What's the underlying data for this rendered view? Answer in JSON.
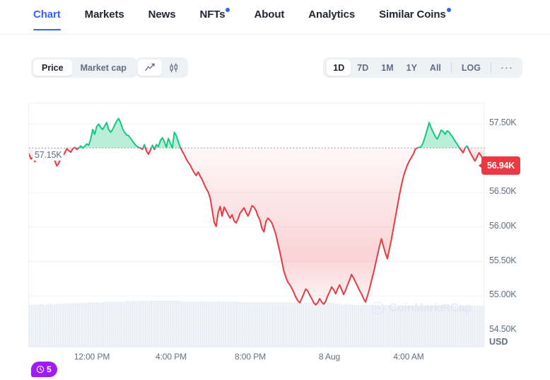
{
  "tabs": [
    {
      "label": "Chart",
      "active": true,
      "dot": false
    },
    {
      "label": "Markets",
      "active": false,
      "dot": false
    },
    {
      "label": "News",
      "active": false,
      "dot": false
    },
    {
      "label": "NFTs",
      "active": false,
      "dot": true
    },
    {
      "label": "About",
      "active": false,
      "dot": false
    },
    {
      "label": "Analytics",
      "active": false,
      "dot": false
    },
    {
      "label": "Similar Coins",
      "active": false,
      "dot": true
    }
  ],
  "controls": {
    "metric_options": [
      "Price",
      "Market cap"
    ],
    "metric_selected": "Price",
    "price_label": "Price",
    "marketcap_label": "Market cap",
    "chart_type_options": [
      "line-chart-icon",
      "candlestick-chart-icon"
    ],
    "chart_type_selected": "line-chart-icon",
    "ranges": [
      "1D",
      "7D",
      "1M",
      "1Y",
      "All"
    ],
    "range_selected": "1D",
    "range_1d": "1D",
    "range_7d": "7D",
    "range_1m": "1M",
    "range_1y": "1Y",
    "range_all": "All",
    "log_label": "LOG",
    "more_label": "···"
  },
  "watermark": "CoinMarketCap",
  "history_badge": {
    "count": "5",
    "icon": "clock-history-icon"
  },
  "current_price_badge": "56.94K",
  "baseline_label": "57.15K",
  "currency_label": "USD",
  "colors": {
    "accent": "#3861fb",
    "up": "#16c784",
    "down": "#ea3943",
    "text": "#222531",
    "muted": "#616e85",
    "grid": "#eff2f5",
    "badge_purple": "#a11cf2"
  },
  "chart_data": {
    "type": "line",
    "title": "",
    "xlabel": "",
    "ylabel": "USD",
    "grid": true,
    "legend": "none",
    "ylim": [
      54250,
      57800
    ],
    "y_ticks": [
      57500,
      56500,
      56000,
      55500,
      55000,
      54500
    ],
    "y_tick_labels": [
      "57.50K",
      "56.50K",
      "56.00K",
      "55.50K",
      "55.00K",
      "54.50K"
    ],
    "x_tick_labels": [
      "12:00 PM",
      "4:00 PM",
      "8:00 PM",
      "8 Aug",
      "4:00 AM"
    ],
    "x_tick_positions": [
      130,
      242,
      354,
      466,
      578
    ],
    "baseline": 57150,
    "baseline_label": "57.15K",
    "last_value": 56940,
    "last_value_label": "56.94K",
    "series_name": "Price",
    "up_color": "#16c784",
    "down_color": "#ea3943",
    "values": [
      57060,
      56990,
      57010,
      56950,
      57060,
      57010,
      57080,
      57020,
      56990,
      57060,
      57100,
      57060,
      57010,
      56960,
      56890,
      56930,
      57000,
      57040,
      57080,
      57140,
      57110,
      57090,
      57140,
      57160,
      57130,
      57150,
      57180,
      57150,
      57175,
      57210,
      57190,
      57280,
      57420,
      57350,
      57460,
      57500,
      57450,
      57420,
      57470,
      57520,
      57420,
      57380,
      57420,
      57480,
      57540,
      57580,
      57520,
      57430,
      57380,
      57340,
      57330,
      57290,
      57250,
      57210,
      57180,
      57160,
      57150,
      57130,
      57200,
      57105,
      57060,
      57120,
      57190,
      57130,
      57200,
      57170,
      57260,
      57300,
      57240,
      57160,
      57290,
      57220,
      57150,
      57380,
      57330,
      57240,
      57160,
      57100,
      57050,
      56990,
      56940,
      56900,
      56840,
      56790,
      56750,
      56800,
      56740,
      56690,
      56620,
      56560,
      56510,
      56420,
      56250,
      56070,
      56010,
      56210,
      56300,
      56160,
      56290,
      56240,
      56180,
      56130,
      56180,
      56090,
      56060,
      56120,
      56200,
      56240,
      56280,
      56210,
      56160,
      56230,
      56310,
      56290,
      56240,
      56160,
      56100,
      55980,
      55930,
      56080,
      56130,
      56100,
      56060,
      55980,
      55890,
      55760,
      55640,
      55500,
      55360,
      55270,
      55200,
      55160,
      55110,
      55050,
      54980,
      54930,
      54900,
      54960,
      55030,
      55100,
      55070,
      55010,
      54960,
      54900,
      54870,
      54900,
      54960,
      54910,
      54880,
      54920,
      55000,
      55060,
      55130,
      55090,
      55030,
      55100,
      55160,
      55090,
      55020,
      55080,
      55160,
      55230,
      55310,
      55260,
      55200,
      55140,
      55080,
      55030,
      54960,
      54910,
      55000,
      55100,
      55220,
      55330,
      55460,
      55590,
      55720,
      55830,
      55720,
      55620,
      55540,
      55680,
      55820,
      55980,
      56140,
      56300,
      56460,
      56600,
      56730,
      56820,
      56900,
      56960,
      57010,
      57060,
      57130,
      57150,
      57160,
      57170,
      57230,
      57320,
      57420,
      57520,
      57440,
      57380,
      57320,
      57280,
      57340,
      57410,
      57390,
      57350,
      57400,
      57380,
      57340,
      57300,
      57250,
      57210,
      57160,
      57120,
      57080,
      57150,
      57180,
      57120,
      57060,
      57010,
      56960,
      57020,
      57080,
      57040,
      56990,
      56940
    ],
    "volume": [
      60,
      60,
      61,
      61,
      60,
      61,
      62,
      61,
      60,
      61,
      62,
      62,
      61,
      60,
      61,
      62,
      62,
      61,
      62,
      62,
      63,
      63,
      62,
      63,
      63,
      62,
      63,
      63,
      63,
      62,
      63,
      64,
      64,
      63,
      64,
      64,
      64,
      63,
      64,
      64,
      65,
      65,
      64,
      65,
      65,
      64,
      65,
      65,
      65,
      64,
      65,
      66,
      66,
      65,
      66,
      66,
      66,
      65,
      66,
      66,
      66,
      66,
      65,
      66,
      66,
      66,
      66,
      66,
      66,
      66,
      66,
      66,
      66,
      66,
      66,
      66,
      66,
      66,
      66,
      66,
      65,
      65,
      65,
      65,
      65,
      65,
      65,
      65,
      65,
      65,
      65,
      65,
      65,
      65,
      65,
      65,
      65,
      65,
      65,
      65,
      65,
      65,
      65,
      65,
      65,
      65,
      65,
      65,
      65,
      65,
      64,
      64,
      64,
      64,
      64,
      64,
      64,
      64,
      64,
      64,
      64,
      64,
      64,
      64,
      64,
      64,
      64,
      64,
      64,
      64,
      64,
      64,
      64,
      64,
      64,
      64,
      64,
      64,
      64,
      64,
      64,
      64,
      64,
      64,
      64,
      64,
      64,
      64,
      64,
      64,
      63,
      63,
      63,
      63,
      63,
      63,
      63,
      63,
      63,
      63,
      62,
      62,
      62,
      62,
      61,
      61,
      61,
      61,
      61,
      61,
      60,
      60,
      60,
      60,
      60,
      60,
      60,
      60,
      60,
      60,
      60,
      60,
      60,
      60,
      60,
      60,
      60,
      60,
      60,
      60,
      59,
      59,
      59,
      59,
      59,
      59,
      59,
      59,
      59,
      59,
      59,
      59,
      59,
      59,
      59,
      59,
      59,
      59,
      59,
      59,
      59,
      59,
      59,
      59,
      59,
      59,
      60,
      60,
      61,
      62,
      60,
      59,
      59,
      59,
      59,
      59,
      59,
      59,
      59,
      59,
      59,
      59,
      59,
      59,
      59,
      59,
      59,
      59,
      59,
      59
    ]
  }
}
